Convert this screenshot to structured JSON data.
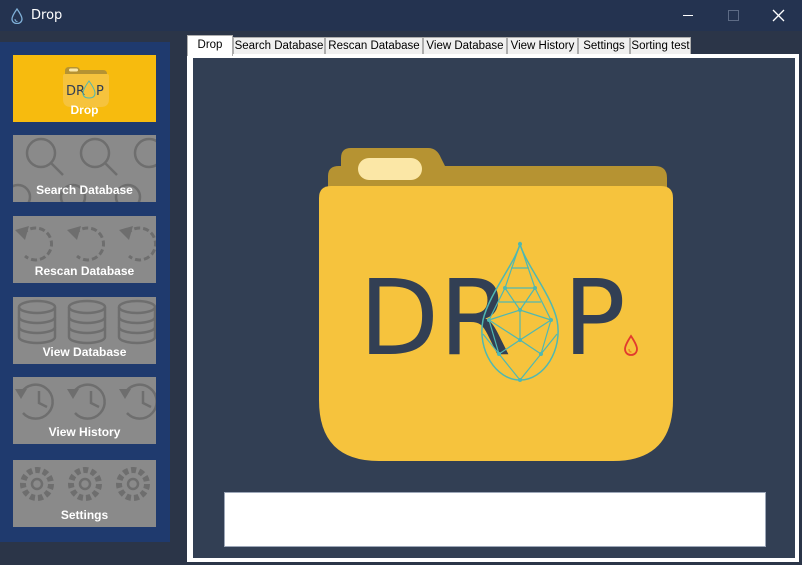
{
  "window": {
    "title": "Drop",
    "icon": "water-drop-icon"
  },
  "colors": {
    "titlebar": "#243350",
    "nav_panel": "#1f3a6e",
    "active_nav": "#f7bb0e",
    "inactive_nav": "#8a8a8a",
    "content_bg": "#323f54",
    "folder_yellow": "#f6c33d",
    "folder_tab": "#b69332",
    "drop_letters": "#323f54",
    "drop_mesh": "#4fb8b2"
  },
  "nav": [
    {
      "label": "Drop",
      "icon": "drop-folder-icon",
      "active": true
    },
    {
      "label": "Search Database",
      "icon": "magnifier-icon",
      "active": false
    },
    {
      "label": "Rescan Database",
      "icon": "refresh-icon",
      "active": false
    },
    {
      "label": "View Database",
      "icon": "database-icon",
      "active": false
    },
    {
      "label": "View History",
      "icon": "history-clock-icon",
      "active": false
    },
    {
      "label": "Settings",
      "icon": "gear-icon",
      "active": false
    }
  ],
  "tabs": [
    {
      "label": "Drop",
      "selected": true
    },
    {
      "label": "Search Database",
      "selected": false
    },
    {
      "label": "Rescan Database",
      "selected": false
    },
    {
      "label": "View Database",
      "selected": false
    },
    {
      "label": "View History",
      "selected": false
    },
    {
      "label": "Settings",
      "selected": false
    },
    {
      "label": "Sorting test",
      "selected": false
    }
  ],
  "logo": {
    "text_left": "DR",
    "text_right": "P"
  },
  "nav_logo": {
    "text_left": "DR",
    "text_right": "P"
  }
}
